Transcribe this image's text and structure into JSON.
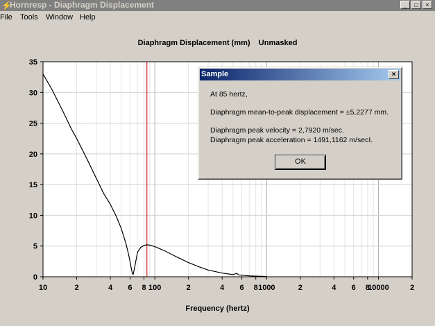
{
  "window": {
    "title": "Hornresp - Diaphragm Displacement",
    "min_glyph": "_",
    "max_glyph": "□",
    "close_glyph": "×"
  },
  "menu": [
    "File",
    "Tools",
    "Window",
    "Help"
  ],
  "chart_title": "Diaphragm Displacement (mm)    Unmasked",
  "chart_data": {
    "type": "line",
    "xlabel": "Frequency (hertz)",
    "ylabel": "",
    "x_scale": "log",
    "xlim": [
      10,
      20000
    ],
    "ylim": [
      0,
      35
    ],
    "y_ticks": [
      "0",
      "5",
      "10",
      "15",
      "20",
      "25",
      "30",
      "35"
    ],
    "x_ticks": [
      {
        "value": 10,
        "label": "10"
      },
      {
        "value": 20,
        "label": "2"
      },
      {
        "value": 40,
        "label": "4"
      },
      {
        "value": 60,
        "label": "6"
      },
      {
        "value": 80,
        "label": "8"
      },
      {
        "value": 100,
        "label": "100"
      },
      {
        "value": 200,
        "label": "2"
      },
      {
        "value": 400,
        "label": "4"
      },
      {
        "value": 600,
        "label": "6"
      },
      {
        "value": 800,
        "label": "8"
      },
      {
        "value": 1000,
        "label": "1000"
      },
      {
        "value": 2000,
        "label": "2"
      },
      {
        "value": 4000,
        "label": "4"
      },
      {
        "value": 6000,
        "label": "6"
      },
      {
        "value": 8000,
        "label": "8"
      },
      {
        "value": 10000,
        "label": "10000"
      },
      {
        "value": 20000,
        "label": "2"
      }
    ],
    "grid": true,
    "marker_frequency": 85,
    "series": [
      {
        "x": [
          10,
          12,
          15,
          18,
          20,
          25,
          30,
          35,
          40,
          45,
          50,
          55,
          58,
          60,
          62,
          63,
          64,
          66,
          68,
          70,
          75,
          80,
          85,
          90,
          100,
          120,
          150,
          200,
          250,
          300,
          400,
          500,
          540,
          560,
          600,
          700,
          800,
          900,
          1000
        ],
        "y": [
          33,
          30.5,
          27,
          24,
          22.5,
          19,
          16,
          13.5,
          11.8,
          9.9,
          7.9,
          5.5,
          3.8,
          2.5,
          1.1,
          0.5,
          0.4,
          1.5,
          2.8,
          4.0,
          4.8,
          5.1,
          5.2,
          5.15,
          4.9,
          4.3,
          3.4,
          2.3,
          1.6,
          1.1,
          0.6,
          0.35,
          0.55,
          0.3,
          0.25,
          0.15,
          0.1,
          0.08,
          0.05
        ]
      }
    ]
  },
  "dialog": {
    "title": "Sample",
    "close_glyph": "×",
    "line1": "At 85 hertz,",
    "line2": "Diaphragm mean-to-peak displacement = ±5,2277 mm.",
    "line3": "Diaphragm peak velocity = 2,7920 m/sec.",
    "line4": "Diaphragm peak acceleration = 1491,1162 m/secI.",
    "ok_label": "OK"
  },
  "colors": {
    "curve": "#000000",
    "marker": "#cc0000",
    "grid": "#c0c0c0",
    "plot_background": "#ffffff"
  }
}
